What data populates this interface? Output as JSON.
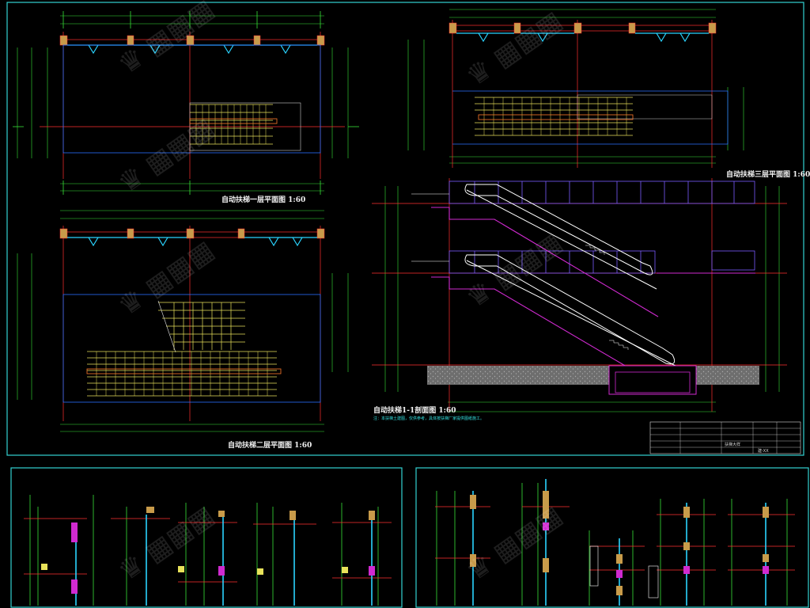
{
  "drawing": {
    "background": "#000000",
    "frame_color": "#33d1d1",
    "colors": {
      "wall": "#ff3030",
      "glass": "#2ad4ff",
      "escalator": "#e8e25a",
      "handrail": "#ff7a2b",
      "magenta": "#d02ad0",
      "violet": "#7a5cff",
      "dim": "#36e336",
      "text": "#f0f0f0",
      "ground": "#8c8c8c",
      "column": "#c89b4a"
    },
    "views": [
      {
        "id": "plan-1",
        "title": "自动扶梯一层平面图  1:60"
      },
      {
        "id": "plan-2",
        "title": "自动扶梯二层平面图  1:60"
      },
      {
        "id": "plan-3",
        "title": "自动扶梯三层平面图  1:60"
      },
      {
        "id": "section",
        "title": "自动扶梯1-1剖面图  1:60"
      }
    ],
    "section_note": "注：本扶梯土建图，仅供参考，具体按扶梯厂家提供图纸施工。",
    "title_block": {
      "rows": [
        "",
        "",
        "",
        "",
        ""
      ],
      "sheet_label": "扶梯大样",
      "sheet_no": "建-XX"
    },
    "watermark_icon": "logo-watermark"
  }
}
